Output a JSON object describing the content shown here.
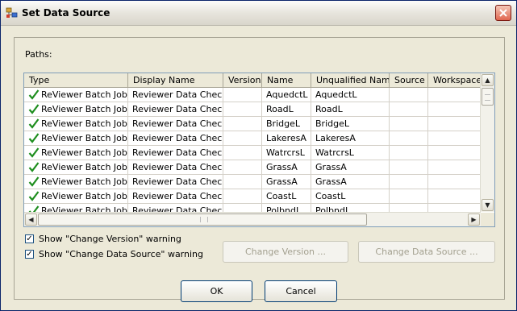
{
  "window": {
    "title": "Set Data Source"
  },
  "paths_label": "Paths:",
  "grid": {
    "columns": [
      "Type",
      "Display Name",
      "Version",
      "Name",
      "Unqualified Name",
      "Source",
      "Workspace"
    ],
    "rows": [
      {
        "type": "ReViewer Batch Job...",
        "display_name": "Reviewer Data Check",
        "version": "",
        "name": "AquedctL",
        "unqualified_name": "AquedctL",
        "source": "",
        "workspace": ""
      },
      {
        "type": "ReViewer Batch Job...",
        "display_name": "Reviewer Data Check",
        "version": "",
        "name": "RoadL",
        "unqualified_name": "RoadL",
        "source": "",
        "workspace": ""
      },
      {
        "type": "ReViewer Batch Job...",
        "display_name": "Reviewer Data Check",
        "version": "",
        "name": "BridgeL",
        "unqualified_name": "BridgeL",
        "source": "",
        "workspace": ""
      },
      {
        "type": "ReViewer Batch Job...",
        "display_name": "Reviewer Data Check",
        "version": "",
        "name": "LakeresA",
        "unqualified_name": "LakeresA",
        "source": "",
        "workspace": ""
      },
      {
        "type": "ReViewer Batch Job...",
        "display_name": "Reviewer Data Check",
        "version": "",
        "name": "WatrcrsL",
        "unqualified_name": "WatrcrsL",
        "source": "",
        "workspace": ""
      },
      {
        "type": "ReViewer Batch Job...",
        "display_name": "Reviewer Data Check",
        "version": "",
        "name": "GrassA",
        "unqualified_name": "GrassA",
        "source": "",
        "workspace": ""
      },
      {
        "type": "ReViewer Batch Job...",
        "display_name": "Reviewer Data Check",
        "version": "",
        "name": "GrassA",
        "unqualified_name": "GrassA",
        "source": "",
        "workspace": ""
      },
      {
        "type": "ReViewer Batch Job...",
        "display_name": "Reviewer Data Check",
        "version": "",
        "name": "CoastL",
        "unqualified_name": "CoastL",
        "source": "",
        "workspace": ""
      },
      {
        "type": "ReViewer Batch Job...",
        "display_name": "Reviewer Data Check",
        "version": "",
        "name": "PolbndL",
        "unqualified_name": "PolbndL",
        "source": "",
        "workspace": ""
      }
    ],
    "row_icon": "green-check-icon"
  },
  "checkboxes": {
    "change_version_warning": {
      "label": "Show \"Change Version\" warning",
      "checked": true
    },
    "change_data_source_warning": {
      "label": "Show \"Change Data Source\" warning",
      "checked": true
    }
  },
  "buttons": {
    "change_version": "Change Version ...",
    "change_data_source": "Change Data Source ...",
    "ok": "OK",
    "cancel": "Cancel"
  },
  "colors": {
    "check": "#1e8e1e",
    "close_button": "#e0664f",
    "disabled_text": "#a3a08f"
  }
}
